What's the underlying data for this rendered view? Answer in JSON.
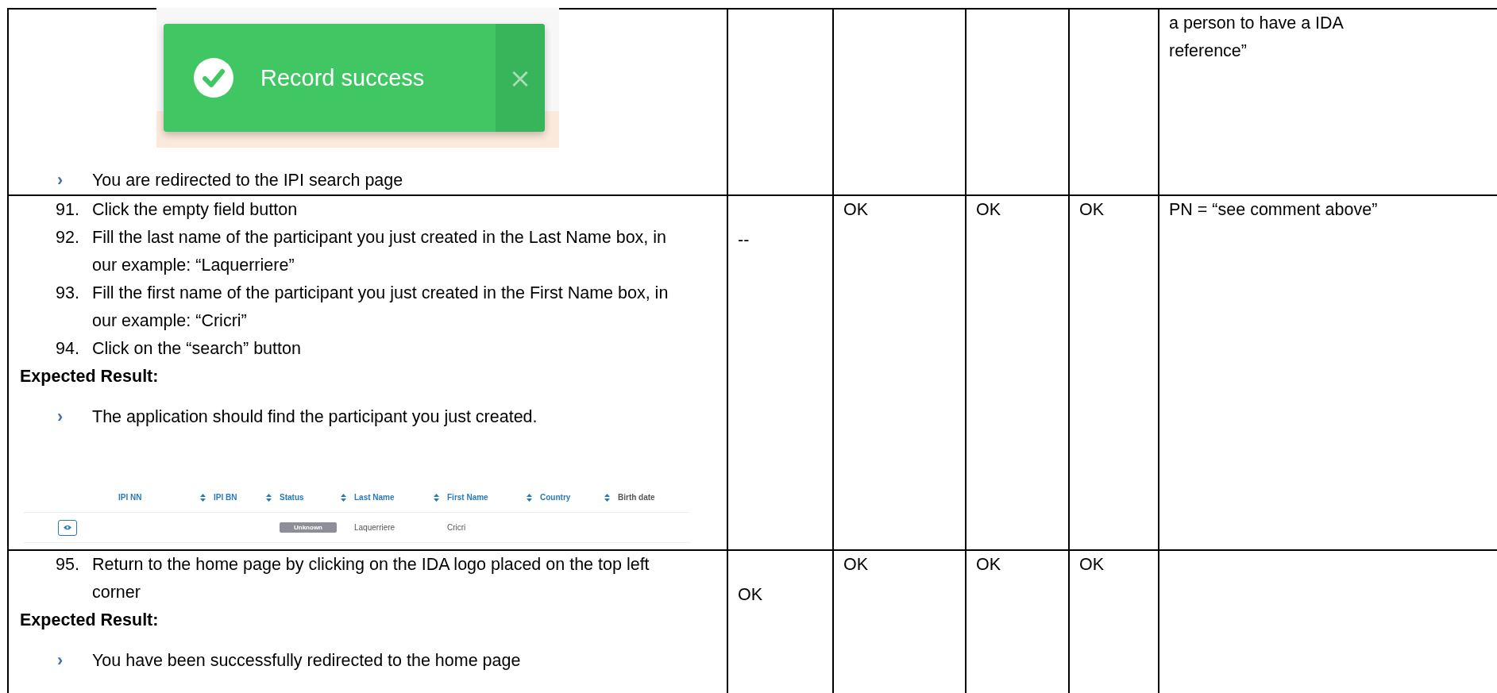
{
  "rows": [
    {
      "content": [
        {
          "kind": "toast",
          "message": "Record success",
          "close": "×"
        },
        {
          "kind": "bullet",
          "marker": "›",
          "text": "You are redirected to the IPI search page"
        }
      ],
      "comment": "a person to have a IDA reference”"
    },
    {
      "content": [
        {
          "kind": "step",
          "number": "91.",
          "text": "Click the empty field button"
        },
        {
          "kind": "step",
          "number": "92.",
          "text": "Fill the last name of the participant you just created in the Last Name box, in our example: “Laquerriere”"
        },
        {
          "kind": "step",
          "number": "93.",
          "text": "Fill the first name of the participant you just created in the First Name box, in our example: “Cricri”"
        },
        {
          "kind": "step",
          "number": "94.",
          "text": "Click on the “search” button"
        },
        {
          "kind": "heading",
          "text": "Expected Result:"
        },
        {
          "kind": "bullet",
          "marker": "›",
          "text": "The application should find the participant you just created."
        },
        {
          "kind": "results_table",
          "columns": [
            {
              "label": "IPI NN",
              "sortable": true
            },
            {
              "label": "IPI BN",
              "sortable": true
            },
            {
              "label": "Status",
              "sortable": true
            },
            {
              "label": "Last Name",
              "sortable": true
            },
            {
              "label": "First Name",
              "sortable": true
            },
            {
              "label": "Country",
              "sortable": true
            },
            {
              "label": "Birth date",
              "sortable": false
            }
          ],
          "rows": [
            {
              "status": "Unknown",
              "last_name": "Laquerriere",
              "first_name": "Cricri"
            }
          ]
        }
      ],
      "column_2": "--",
      "column_3": "OK",
      "column_4": "OK",
      "column_5": "OK",
      "comment": "PN = “see comment above”"
    },
    {
      "content": [
        {
          "kind": "step",
          "number": "95.",
          "text": "Return to the home page by clicking on the IDA logo placed on the top left corner"
        },
        {
          "kind": "heading",
          "text": "Expected Result:"
        },
        {
          "kind": "bullet",
          "marker": "›",
          "text": "You have been successfully redirected to the home page"
        }
      ],
      "column_2": "OK",
      "column_3": "OK",
      "column_4": "OK",
      "column_5": "OK"
    }
  ]
}
